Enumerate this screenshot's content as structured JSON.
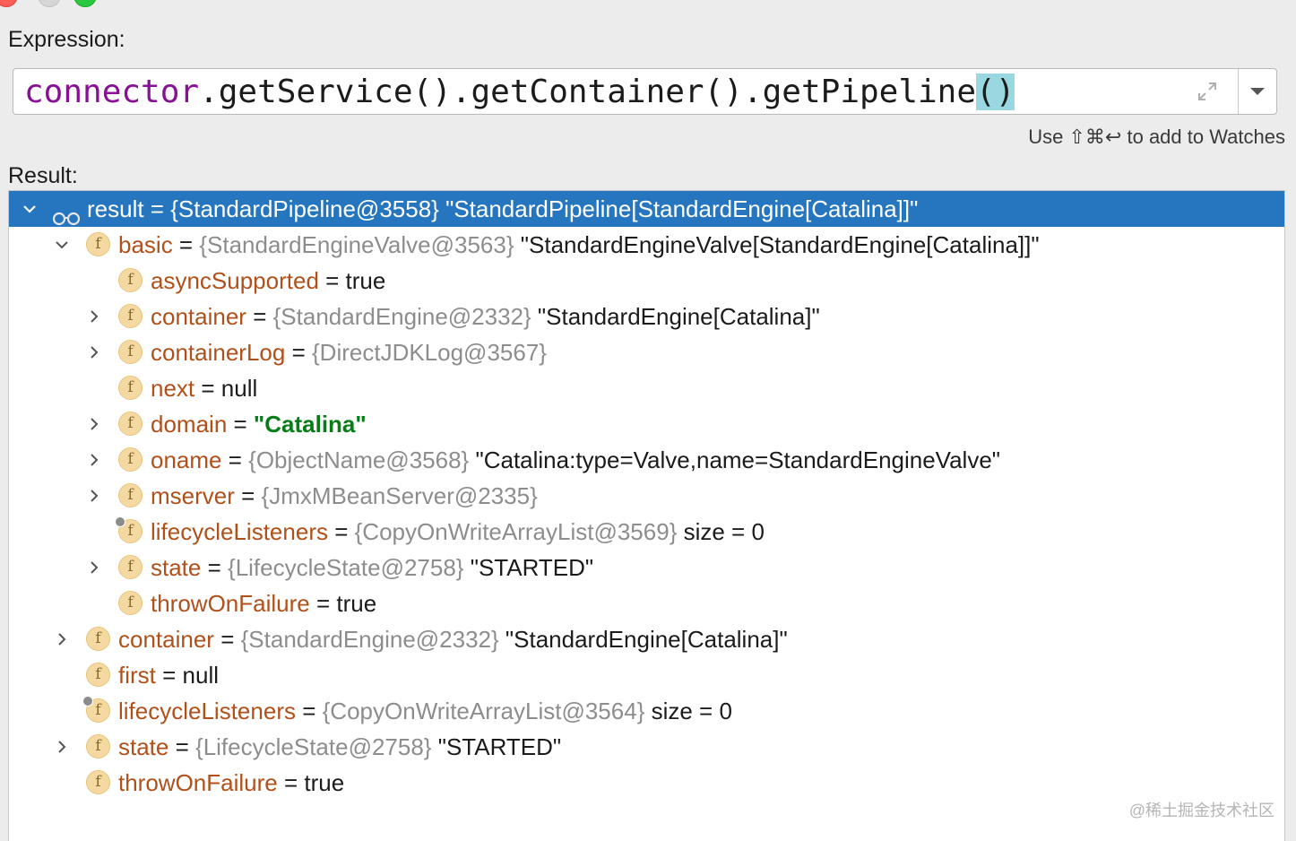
{
  "window": {
    "title_fragment": "· · ·"
  },
  "expression": {
    "label": "Expression:",
    "var_part": "connector",
    "call_part": ".getService().getContainer().getPipeline",
    "paren_part": "()"
  },
  "hint": "Use ⇧⌘↩ to add to Watches",
  "result_label": "Result:",
  "tree": {
    "root": {
      "name": "result",
      "eq": " = ",
      "ref": "{StandardPipeline@3558}",
      "value": " \"StandardPipeline[StandardEngine[Catalina]]\""
    },
    "basic": {
      "name": "basic",
      "eq": " = ",
      "ref": "{StandardEngineValve@3563}",
      "value": " \"StandardEngineValve[StandardEngine[Catalina]]\"",
      "children": {
        "asyncSupported": {
          "name": "asyncSupported",
          "eq": " = ",
          "value": "true"
        },
        "container": {
          "name": "container",
          "eq": " = ",
          "ref": "{StandardEngine@2332}",
          "value": " \"StandardEngine[Catalina]\""
        },
        "containerLog": {
          "name": "containerLog",
          "eq": " = ",
          "ref": "{DirectJDKLog@3567}"
        },
        "next": {
          "name": "next",
          "eq": " = ",
          "value": "null"
        },
        "domain": {
          "name": "domain",
          "eq": " = ",
          "value": "\"Catalina\""
        },
        "oname": {
          "name": "oname",
          "eq": " = ",
          "ref": "{ObjectName@3568}",
          "value": " \"Catalina:type=Valve,name=StandardEngineValve\""
        },
        "mserver": {
          "name": "mserver",
          "eq": " = ",
          "ref": "{JmxMBeanServer@2335}"
        },
        "lifecycleListeners": {
          "name": "lifecycleListeners",
          "eq": " = ",
          "ref": "{CopyOnWriteArrayList@3569}",
          "value": "  size = 0"
        },
        "state": {
          "name": "state",
          "eq": " = ",
          "ref": "{LifecycleState@2758}",
          "value": " \"STARTED\""
        },
        "throwOnFailure": {
          "name": "throwOnFailure",
          "eq": " = ",
          "value": "true"
        }
      }
    },
    "container": {
      "name": "container",
      "eq": " = ",
      "ref": "{StandardEngine@2332}",
      "value": " \"StandardEngine[Catalina]\""
    },
    "first": {
      "name": "first",
      "eq": " = ",
      "value": "null"
    },
    "lifecycleListeners": {
      "name": "lifecycleListeners",
      "eq": " = ",
      "ref": "{CopyOnWriteArrayList@3564}",
      "value": "  size = 0"
    },
    "state": {
      "name": "state",
      "eq": " = ",
      "ref": "{LifecycleState@2758}",
      "value": " \"STARTED\""
    },
    "throwOnFailure": {
      "name": "throwOnFailure",
      "eq": " = ",
      "value": "true"
    }
  },
  "field_icon_letter": "f",
  "watermark": "@稀土掘金技术社区",
  "colors": {
    "selection": "#2675bf",
    "field_name": "#b0501a",
    "ref": "#8d8d8d",
    "string_green": "#067d17",
    "expression_var": "#871094",
    "paren_highlight": "#99d8e0"
  }
}
